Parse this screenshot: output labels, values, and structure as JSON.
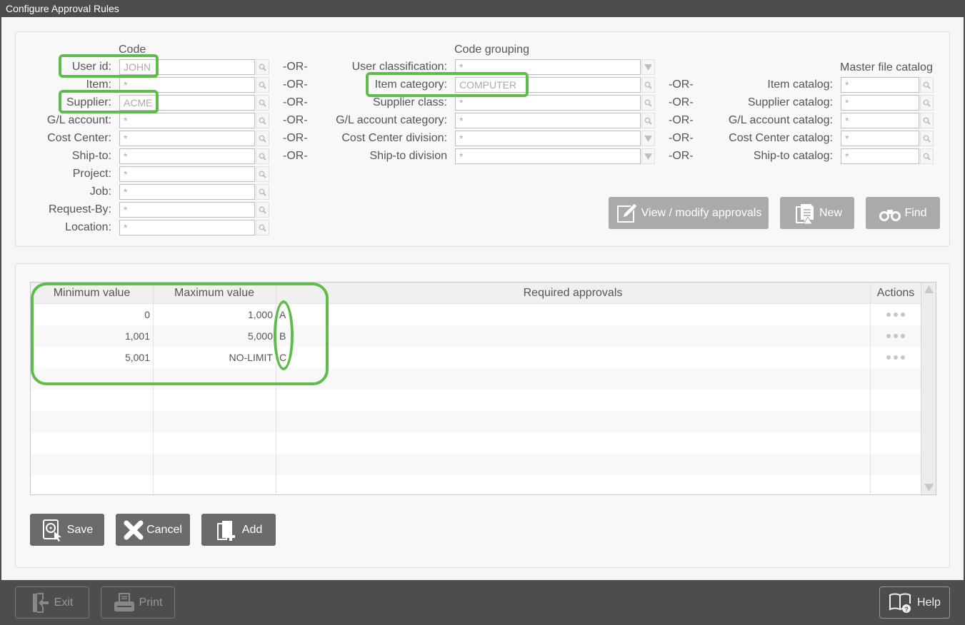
{
  "window": {
    "title": "Configure Approval Rules"
  },
  "filters": {
    "code_header": "Code",
    "grouping_header": "Code grouping",
    "catalog_header": "Master file catalog",
    "or_text": "-OR-",
    "code_fields": [
      {
        "label": "User id:",
        "value": "JOHN"
      },
      {
        "label": "Item:",
        "value": "*"
      },
      {
        "label": "Supplier:",
        "value": "ACME"
      },
      {
        "label": "G/L account:",
        "value": "*"
      },
      {
        "label": "Cost Center:",
        "value": "*"
      },
      {
        "label": "Ship-to:",
        "value": "*"
      },
      {
        "label": "Project:",
        "value": "*"
      },
      {
        "label": "Job:",
        "value": "*"
      },
      {
        "label": "Request-By:",
        "value": "*"
      },
      {
        "label": "Location:",
        "value": "*"
      }
    ],
    "grouping_fields": [
      {
        "label": "User classification:",
        "value": "*",
        "control": "dropdown"
      },
      {
        "label": "Item category:",
        "value": "COMPUTER",
        "control": "lookup"
      },
      {
        "label": "Supplier class:",
        "value": "*",
        "control": "lookup"
      },
      {
        "label": "G/L account category:",
        "value": "*",
        "control": "lookup"
      },
      {
        "label": "Cost Center division:",
        "value": "*",
        "control": "dropdown"
      },
      {
        "label": "Ship-to division",
        "value": "*",
        "control": "dropdown"
      }
    ],
    "catalog_fields": [
      {
        "label": "Item catalog:",
        "value": "*"
      },
      {
        "label": "Supplier catalog:",
        "value": "*"
      },
      {
        "label": "G/L account catalog:",
        "value": "*"
      },
      {
        "label": "Cost Center catalog:",
        "value": "*"
      },
      {
        "label": "Ship-to catalog:",
        "value": "*"
      }
    ]
  },
  "actions": {
    "view_modify": "View / modify approvals",
    "new": "New",
    "find": "Find"
  },
  "table": {
    "columns": [
      "Minimum value",
      "Maximum value",
      "Required approvals",
      "Actions"
    ],
    "rows": [
      {
        "min": "0",
        "max": "1,000",
        "approvals": "A"
      },
      {
        "min": "1,001",
        "max": "5,000",
        "approvals": "B"
      },
      {
        "min": "5,001",
        "max": "NO-LIMIT",
        "approvals": "C"
      }
    ]
  },
  "form_buttons": {
    "save": "Save",
    "cancel": "Cancel",
    "add": "Add"
  },
  "footer": {
    "exit": "Exit",
    "print": "Print",
    "help": "Help"
  },
  "colors": {
    "highlight": "#5ebc4a",
    "titlebar": "#4d4d4d",
    "button_light": "#aaaaaa",
    "button_dark": "#6b6b6b"
  }
}
